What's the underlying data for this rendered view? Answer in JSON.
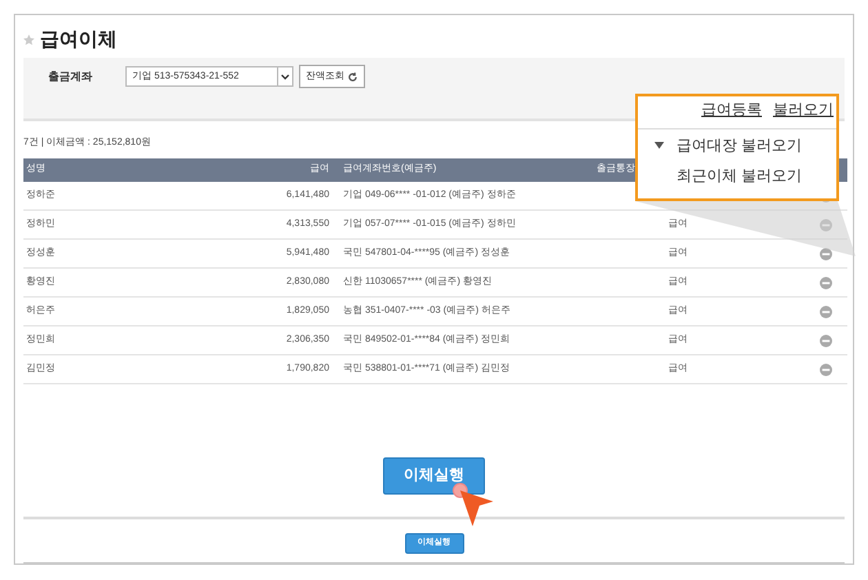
{
  "title": "급여이체",
  "filter": {
    "label": "출금계좌",
    "account": "기업 513-575343-21-552",
    "balance_button": "잔액조회"
  },
  "summary": "7건 | 이체금액 : 25,152,810원",
  "table": {
    "columns": [
      "성명",
      "급여",
      "급여계좌번호(예금주)",
      "출금통장"
    ],
    "rows": [
      {
        "name": "정하준",
        "amount": "6,141,480",
        "account": "기업 049-06**** -01-012 (예금주) 정하준"
      },
      {
        "name": "정하민",
        "amount": "4,313,550",
        "account": "기업 057-07**** -01-015 (예금주) 정하민",
        "memo": "급여"
      },
      {
        "name": "정성훈",
        "amount": "5,941,480",
        "account": "국민 547801-04-****95 (예금주) 정성훈",
        "memo": "급여"
      },
      {
        "name": "황영진",
        "amount": "2,830,080",
        "account": "신한 11030657**** (예금주) 황영진",
        "memo": "급여"
      },
      {
        "name": "허은주",
        "amount": "1,829,050",
        "account": "농협 351-0407-**** -03 (예금주) 허은주",
        "memo": "급여"
      },
      {
        "name": "정민희",
        "amount": "2,306,350",
        "account": "국민 849502-01-****84 (예금주) 정민희",
        "memo": "급여"
      },
      {
        "name": "김민정",
        "amount": "1,790,820",
        "account": "국민 538801-01-****71 (예금주) 김민정",
        "memo": "급여"
      }
    ]
  },
  "callout": {
    "links": [
      "급여등록",
      "불러오기"
    ],
    "menu": [
      "급여대장 불러오기",
      "최근이체 불러오기"
    ]
  },
  "execute_button_large": "이체실행",
  "execute_button_small": "이체실행"
}
